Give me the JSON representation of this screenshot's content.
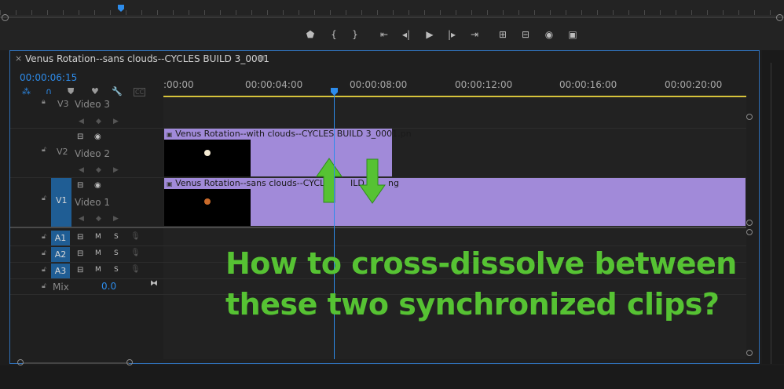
{
  "sequence": {
    "title": "Venus Rotation--sans clouds--CYCLES BUILD 3_0001",
    "close_glyph": "×",
    "menu_glyph": "≡",
    "timecode": "00:00:06:15"
  },
  "transport": [
    "marker-icon",
    "mark-in-icon",
    "mark-out-icon",
    "go-to-in-icon",
    "step-back-icon",
    "play-icon",
    "step-forward-icon",
    "go-to-out-icon",
    "lift-icon",
    "extract-icon",
    "export-frame-icon",
    "compare-view-icon"
  ],
  "transport_glyphs": [
    "⬟",
    "{",
    "}",
    "⇤",
    "◂|",
    "▶",
    "|▸",
    "⇥",
    "⊞",
    "⊟",
    "◉",
    "▣"
  ],
  "tools": {
    "snap": "⁂",
    "link": "∩",
    "markers": "⛊",
    "marker": "♥",
    "wrench": "🔧",
    "captions": "CC"
  },
  "ruler": {
    "labels": [
      ":00:00",
      "00:00:04:00",
      "00:00:08:00",
      "00:00:12:00",
      "00:00:16:00",
      "00:00:20:00"
    ]
  },
  "tracks": {
    "v3": {
      "id": "V3",
      "name": "Video 3"
    },
    "v2": {
      "id": "V2",
      "name": "Video 2"
    },
    "v1": {
      "id": "V1",
      "name": "Video 1"
    },
    "a1": {
      "id": "A1",
      "m": "M",
      "s": "S"
    },
    "a2": {
      "id": "A2",
      "m": "M",
      "s": "S"
    },
    "a3": {
      "id": "A3",
      "m": "M",
      "s": "S"
    },
    "mix": {
      "label": "Mix",
      "value": "0.0"
    }
  },
  "clips": {
    "v2": "Venus Rotation--with clouds--CYCLES BUILD 3_0001.pn",
    "v1a": "Venus Rotation--sans clouds--CYCLES",
    "v1b": "ILD 3_",
    "v1c": "ng"
  },
  "overlay": {
    "line1": "How to cross-dissolve between",
    "line2": "these two synchronized clips?"
  },
  "colors": {
    "clip": "#a18ad9",
    "accent": "#2d8ceb",
    "overlay_text": "#56c233"
  }
}
